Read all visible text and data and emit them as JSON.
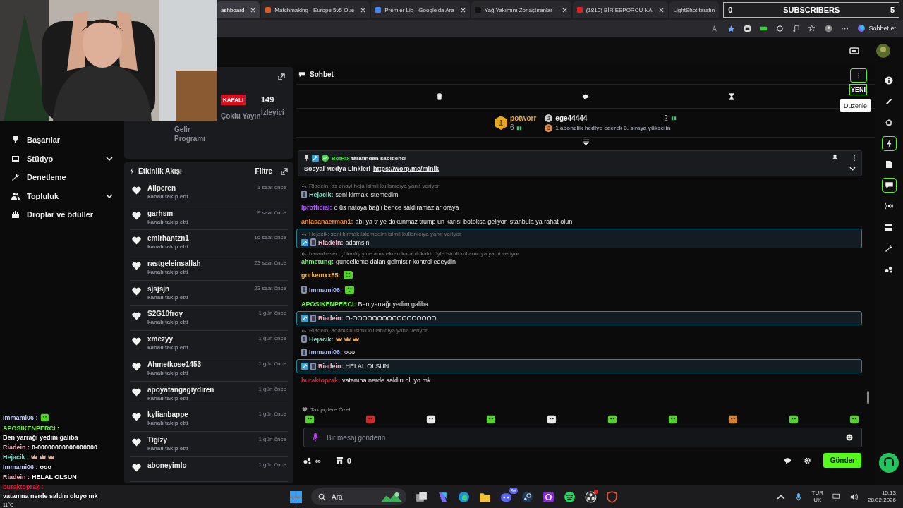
{
  "browser": {
    "tabs": [
      {
        "title": "ashboard",
        "selected": true
      },
      {
        "title": "Matchmaking - Europe 5v5 Que",
        "selected": false
      },
      {
        "title": "Premier Lig - Google'da Ara",
        "selected": false
      },
      {
        "title": "Yağ Yakımını Zorlaştıranlar -",
        "selected": false
      },
      {
        "title": "(1810) BİR ESPORCU NA",
        "selected": false
      },
      {
        "title": "LightShot tarafın",
        "selected": false
      }
    ],
    "copilot": "Sohbet et"
  },
  "stream_overlay": {
    "left_count": "0",
    "label": "SUBSCRIBERS",
    "right_count": "5",
    "weather": "11°C",
    "chat": [
      {
        "user": "Immami06 :",
        "color": "#c9d4ff",
        "kind": "emote"
      },
      {
        "user": "APOSIKENPERCI :",
        "color": "#66ff33",
        "kind": "text",
        "text": "Ben yarrağı yedim galiba"
      },
      {
        "user": "Riadein :",
        "color": "#f4b6c4",
        "kind": "text",
        "text": "0-00000000000000000"
      },
      {
        "user": "Hejacik :",
        "color": "#7fe0c8",
        "kind": "crowns"
      },
      {
        "user": "Immami06 :",
        "color": "#c9d4ff",
        "kind": "text",
        "text": "ooo"
      },
      {
        "user": "Riadein :",
        "color": "#f4b6c4",
        "kind": "text",
        "text": "HELAL OLSUN"
      },
      {
        "user": "buraktoprak :",
        "color": "#e0203a",
        "kind": "text",
        "text": "vatanına nerde saldırı oluyo mk"
      }
    ]
  },
  "sidebar": {
    "items": [
      {
        "label": "Başarılar",
        "expandable": false
      },
      {
        "label": "Stüdyo",
        "expandable": true
      },
      {
        "label": "Denetleme",
        "expandable": false
      },
      {
        "label": "Topluluk",
        "expandable": true
      },
      {
        "label": "Droplar ve ödüller",
        "expandable": false
      }
    ]
  },
  "stats": {
    "revenue_label": "Gelir Programı",
    "multistream_status": "KAPALI",
    "multistream_label": "Çoklu Yayın",
    "viewers": "149",
    "viewers_label": "İzleyici"
  },
  "activity": {
    "title": "Etkinlik Akışı",
    "filter": "Filtre",
    "events": [
      {
        "user": "Aliperen",
        "action": "kanalı takip etti",
        "time": "1 saat önce"
      },
      {
        "user": "garhsm",
        "action": "kanalı takip etti",
        "time": "9 saat önce"
      },
      {
        "user": "emirhantzn1",
        "action": "kanalı takip etti",
        "time": "16 saat önce"
      },
      {
        "user": "rastgeleinsallah",
        "action": "kanalı takip etti",
        "time": "23 saat önce"
      },
      {
        "user": "sjsjsjn",
        "action": "kanalı takip etti",
        "time": "23 saat önce"
      },
      {
        "user": "S2G10froy",
        "action": "kanalı takip etti",
        "time": "1 gün önce"
      },
      {
        "user": "xmezyy",
        "action": "kanalı takip etti",
        "time": "1 gün önce"
      },
      {
        "user": "Ahmetkose1453",
        "action": "kanalı takip etti",
        "time": "1 gün önce"
      },
      {
        "user": "apoyatangagiydiren",
        "action": "kanalı takip etti",
        "time": "1 gün önce"
      },
      {
        "user": "kylianbappe",
        "action": "kanalı takip etti",
        "time": "1 gün önce"
      },
      {
        "user": "Tigizy",
        "action": "kanalı takip etti",
        "time": "1 gün önce"
      },
      {
        "user": "aboneyimlo",
        "time": "1 gün önce"
      }
    ]
  },
  "chat": {
    "title": "Sohbet",
    "new_badge": "YENI",
    "tooltip": "Düzenle",
    "leaderboard": [
      {
        "rank": "1",
        "user": "potworr",
        "count": "6"
      },
      {
        "rank": "2",
        "user": "ege44444",
        "count": "2"
      }
    ],
    "hint": {
      "rank": "3",
      "text": "1 abonelik hediye ederek 3. sıraya yükselin"
    },
    "pinned": {
      "by": "BotRix",
      "suffix": "tarafından sabitlendi",
      "text": "Sosyal Medya Linkleri",
      "link": "https://worp.me/minik"
    },
    "messages": [
      {
        "reply": "Riadein: as enayi heja isimli kullanıcıya yanıt veriyor",
        "badges": [
          {
            "kind": "subscriber"
          }
        ],
        "user": "Hejacik:",
        "color": "#7fe0c8",
        "kind": "text",
        "text": "seni kirmak istemedim",
        "highlighted": false
      },
      {
        "user": "lprofficial:",
        "color": "#b05cff",
        "kind": "text",
        "text": "o üs natoya bağlı bence saldıramazlar oraya",
        "highlighted": false
      },
      {
        "user": "anlasanaerman1:",
        "color": "#f08a24",
        "kind": "text",
        "text": "abı ya tr ye dokunmaz trump un karısı botoksa geliyor ıstanbula ya rahat olun",
        "highlighted": false
      },
      {
        "reply": "Hejacik: seni kirmak istemedim isimli kullanıcıya yanıt veriyor",
        "badges": [
          {
            "kind": "moderator"
          },
          {
            "kind": "subscriber"
          }
        ],
        "user": "Riadein:",
        "color": "#f4b6c4",
        "kind": "text",
        "text": "adamsin",
        "highlighted": true
      },
      {
        "reply": "baranbaser: çökmüş yine amk ekran karardı kaldı öyle isimli kullanıcıya yanıt veriyor",
        "user": "ahmetung:",
        "color": "#5cff5c",
        "kind": "text",
        "text": "guncelleme dalan gelmistir kontrol edeydin",
        "highlighted": false
      },
      {
        "user": "gorkemxx85:",
        "color": "#f0b040",
        "kind": "emote",
        "highlighted": false
      },
      {
        "badges": [
          {
            "kind": "subscriber"
          }
        ],
        "user": "Immami06:",
        "color": "#a8b8ff",
        "kind": "emote",
        "highlighted": false
      },
      {
        "user": "APOSIKENPERCI:",
        "color": "#66ff33",
        "kind": "text",
        "text": "Ben yarrağı yedim galiba",
        "highlighted": false
      },
      {
        "badges": [
          {
            "kind": "moderator"
          },
          {
            "kind": "subscriber"
          }
        ],
        "user": "Riadein:",
        "color": "#f4b6c4",
        "kind": "text",
        "text": "O-OOOOOOOOOOOOOOOOO",
        "highlighted": true
      },
      {
        "reply": "Riadein: adamsin isimli kullanıcıya yanıt veriyor",
        "badges": [
          {
            "kind": "subscriber"
          }
        ],
        "user": "Hejacik:",
        "color": "#7fe0c8",
        "kind": "crowns",
        "highlighted": false
      },
      {
        "badges": [
          {
            "kind": "subscriber"
          }
        ],
        "user": "Immami06:",
        "color": "#a8b8ff",
        "kind": "text",
        "text": "ooo",
        "highlighted": false
      },
      {
        "badges": [
          {
            "kind": "moderator"
          },
          {
            "kind": "subscriber"
          }
        ],
        "user": "Riadein:",
        "color": "#f4b6c4",
        "kind": "text",
        "text": "HELAL OLSUN",
        "highlighted": true
      },
      {
        "user": "buraktoprak:",
        "color": "#e0203a",
        "kind": "text",
        "text": "vatanına nerde saldırı oluyo mk",
        "highlighted": false
      }
    ],
    "followers_label": "Takipçilere Özel",
    "placeholder": "Bir mesaj gönderin",
    "points": "∞",
    "shop_count": "0",
    "send": "Gönder"
  },
  "taskbar": {
    "search": "Ara",
    "discord_badge": "9+",
    "lang": "TUR",
    "layout": "UK",
    "time": "15:13",
    "date": "28.02.2026"
  }
}
